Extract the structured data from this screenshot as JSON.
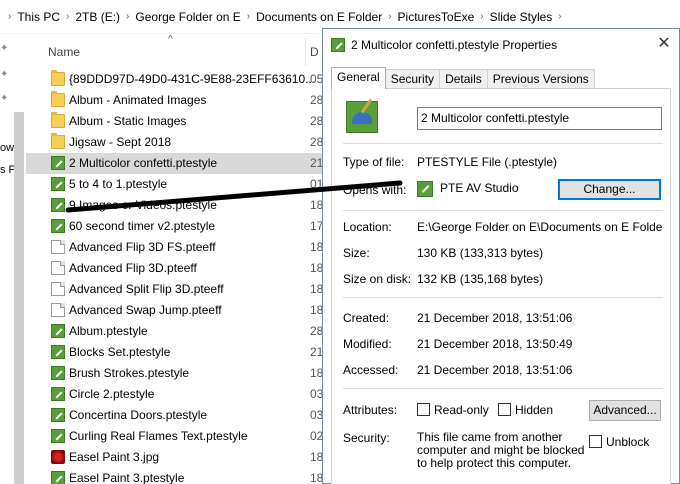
{
  "breadcrumb": [
    "This PC",
    "2TB (E:)",
    "George Folder on E",
    "Documents on E Folder",
    "PicturesToExe",
    "Slide Styles"
  ],
  "nav_fragments": [
    "ow",
    "s P"
  ],
  "columns": {
    "name": "Name",
    "date": "D"
  },
  "files": [
    {
      "name": "{89DDD97D-49D0-431C-9E88-23EFF63610...",
      "date": "05",
      "kind": "folder"
    },
    {
      "name": "Album - Animated Images",
      "date": "28",
      "kind": "folder"
    },
    {
      "name": "Album - Static Images",
      "date": "28",
      "kind": "folder"
    },
    {
      "name": "Jigsaw - Sept 2018",
      "date": "28",
      "kind": "folder"
    },
    {
      "name": "2 Multicolor confetti.ptestyle",
      "date": "21",
      "kind": "pte",
      "selected": true
    },
    {
      "name": "5 to 4 to 1.ptestyle",
      "date": "01",
      "kind": "pte"
    },
    {
      "name": "9 Images or Videos.ptestyle",
      "date": "18",
      "kind": "pte"
    },
    {
      "name": "60 second timer v2.ptestyle",
      "date": "17",
      "kind": "pte"
    },
    {
      "name": "Advanced Flip 3D FS.pteeff",
      "date": "18",
      "kind": "file"
    },
    {
      "name": "Advanced Flip 3D.pteeff",
      "date": "18",
      "kind": "file"
    },
    {
      "name": "Advanced Split Flip 3D.pteeff",
      "date": "18",
      "kind": "file"
    },
    {
      "name": "Advanced Swap Jump.pteeff",
      "date": "18",
      "kind": "file"
    },
    {
      "name": "Album.ptestyle",
      "date": "28",
      "kind": "pte"
    },
    {
      "name": "Blocks Set.ptestyle",
      "date": "21",
      "kind": "pte"
    },
    {
      "name": "Brush Strokes.ptestyle",
      "date": "18",
      "kind": "pte"
    },
    {
      "name": "Circle 2.ptestyle",
      "date": "03",
      "kind": "pte"
    },
    {
      "name": "Concertina Doors.ptestyle",
      "date": "03",
      "kind": "pte"
    },
    {
      "name": "Curling Real Flames Text.ptestyle",
      "date": "02",
      "kind": "pte"
    },
    {
      "name": "Easel Paint 3.jpg",
      "date": "18",
      "kind": "jpg"
    },
    {
      "name": "Easel Paint 3.ptestyle",
      "date": "18",
      "kind": "pte"
    }
  ],
  "dialog": {
    "title": "2 Multicolor confetti.ptestyle Properties",
    "close_glyph": "✕",
    "tabs": [
      "General",
      "Security",
      "Details",
      "Previous Versions"
    ],
    "filename": "2 Multicolor confetti.ptestyle",
    "type_label": "Type of file:",
    "type_value": "PTESTYLE File (.ptestyle)",
    "opens_label": "Opens with:",
    "opens_value": "PTE AV Studio",
    "change_button": "Change...",
    "location_label": "Location:",
    "location_value": "E:\\George Folder on E\\Documents on E Folder\\Pict",
    "size_label": "Size:",
    "size_value": "130 KB (133,313 bytes)",
    "sizeondisk_label": "Size on disk:",
    "sizeondisk_value": "132 KB (135,168 bytes)",
    "created_label": "Created:",
    "created_value": "21 December 2018, 13:51:06",
    "modified_label": "Modified:",
    "modified_value": "21 December 2018, 13:50:49",
    "accessed_label": "Accessed:",
    "accessed_value": "21 December 2018, 13:51:06",
    "attributes_label": "Attributes:",
    "readonly_label": "Read-only",
    "hidden_label": "Hidden",
    "advanced_button": "Advanced...",
    "security_label": "Security:",
    "security_text": "This file came from another computer and might be blocked to help protect this computer.",
    "unblock_label": "Unblock"
  },
  "colors": {
    "selected_row": "#d9d9d9",
    "accent": "#0078d7",
    "dialog_border": "#7a8aa0"
  }
}
